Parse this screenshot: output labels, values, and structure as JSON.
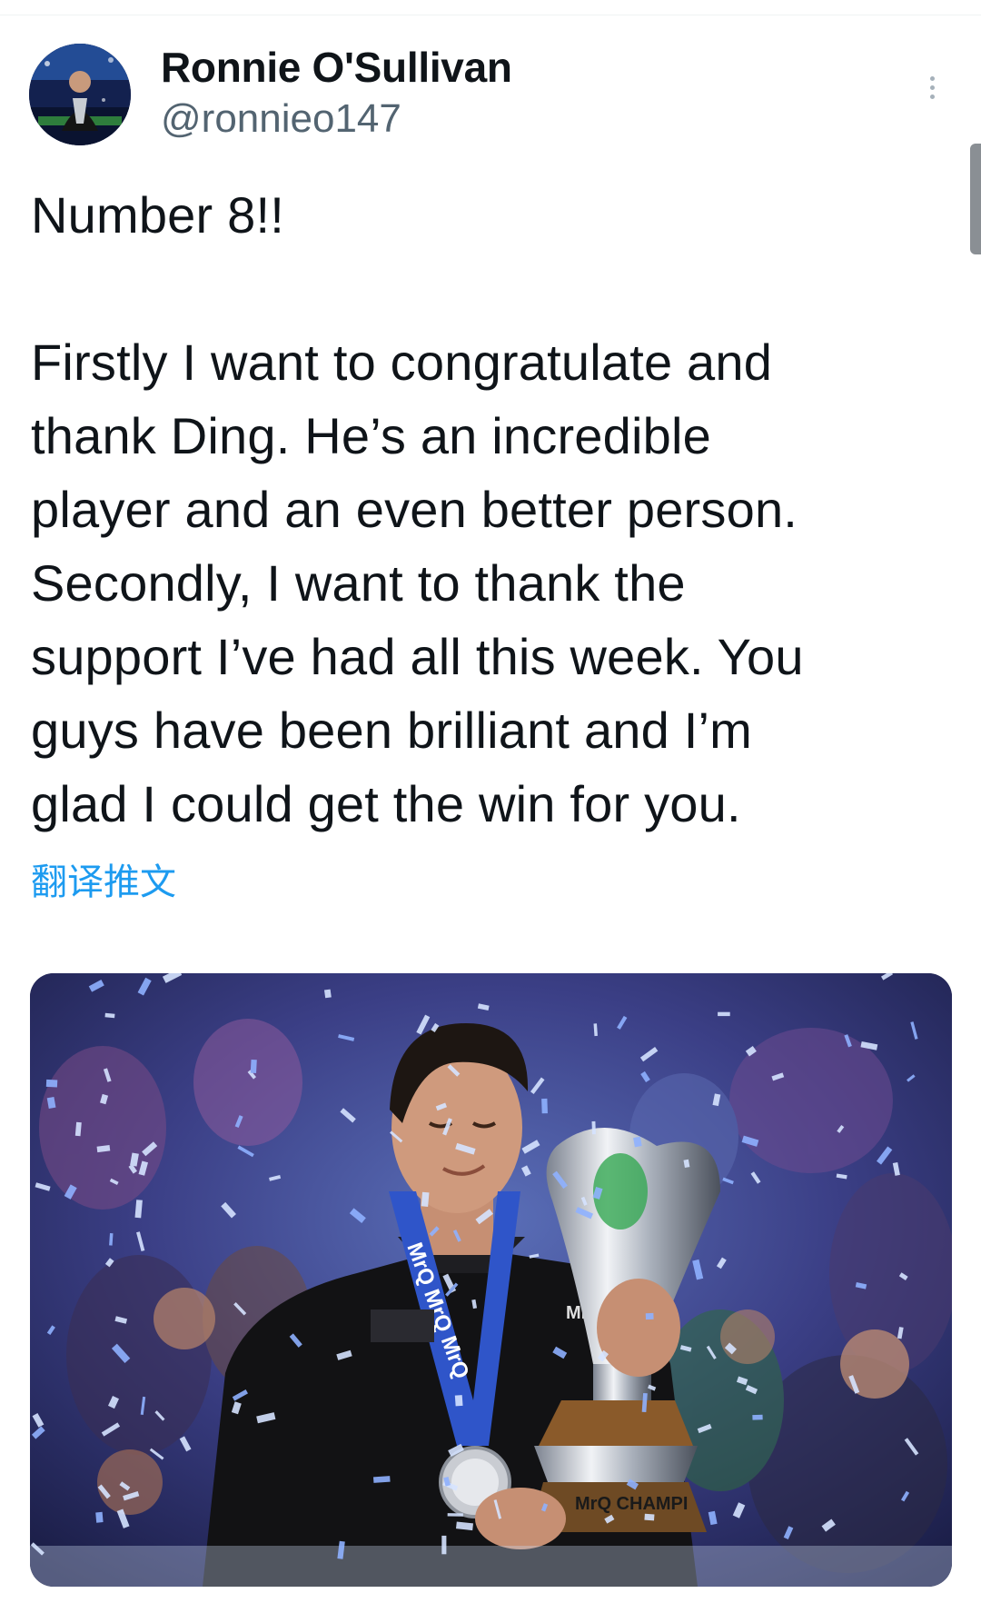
{
  "user": {
    "display_name": "Ronnie O'Sullivan",
    "handle": "@ronnieo147"
  },
  "tweet": {
    "lines": [
      "Number 8!!",
      "",
      "Firstly I want to congratulate and",
      "thank Ding. He’s an incredible",
      "player and an even better person.",
      "Secondly, I want to thank the",
      "support I’ve had all this week. You",
      "guys have been brilliant and I’m",
      "glad I could get the win for you."
    ],
    "translate_label": "翻译推文"
  },
  "media": {
    "shirt_sponsor": "MrQ",
    "lanyard_text": "MrQ MrQ MrQ",
    "trophy_text": "MrQ CHAMPI"
  },
  "icons": {
    "more": "more-vertical-icon"
  },
  "colors": {
    "link": "#1d9bf0",
    "handle": "#536471",
    "text": "#0f1419"
  }
}
